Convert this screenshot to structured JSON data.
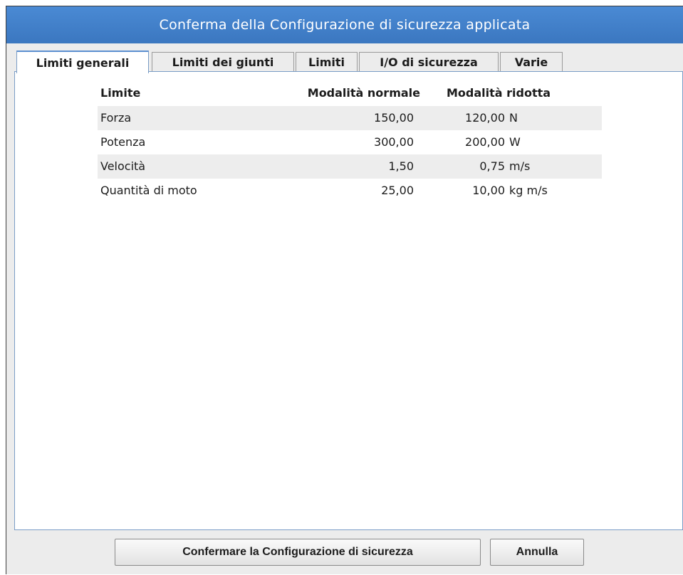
{
  "dialog": {
    "title": "Conferma della Configurazione di sicurezza applicata"
  },
  "tabs": [
    {
      "label": "Limiti generali",
      "active": true
    },
    {
      "label": "Limiti dei giunti",
      "active": false
    },
    {
      "label": "Limiti",
      "active": false
    },
    {
      "label": "I/O di sicurezza",
      "active": false
    },
    {
      "label": "Varie",
      "active": false
    }
  ],
  "table": {
    "headers": {
      "name": "Limite",
      "normal": "Modalità normale",
      "reduced": "Modalità ridotta"
    },
    "rows": [
      {
        "name": "Forza",
        "normal": "150,00",
        "reduced": "120,00",
        "unit": "N"
      },
      {
        "name": "Potenza",
        "normal": "300,00",
        "reduced": "200,00",
        "unit": "W"
      },
      {
        "name": "Velocità",
        "normal": "1,50",
        "reduced": "0,75",
        "unit": "m/s"
      },
      {
        "name": "Quantità di moto",
        "normal": "25,00",
        "reduced": "10,00",
        "unit": "kg m/s"
      }
    ]
  },
  "buttons": {
    "confirm_label": "Confermare la Configurazione di sicurezza",
    "cancel_label": "Annulla"
  },
  "colors": {
    "titlebar": "#3b77c0",
    "row_shade": "#ededed",
    "tab_active_accent": "#5b8fd0"
  }
}
